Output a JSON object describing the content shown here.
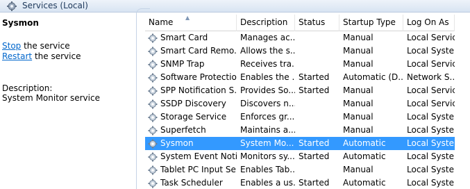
{
  "window": {
    "title": "Services (Local)",
    "icon": "gear-icon"
  },
  "details": {
    "service_name": "Sysmon",
    "stop_link": "Stop",
    "stop_suffix": " the service",
    "restart_link": "Restart",
    "restart_suffix": " the service",
    "description_label": "Description:",
    "description_text": "System Monitor service"
  },
  "list": {
    "columns": {
      "name": "Name",
      "description": "Description",
      "status": "Status",
      "startup_type": "Startup Type",
      "log_on_as": "Log On As"
    },
    "sort_column": "Name",
    "sort_direction": "ascending",
    "selection_color": "#3399ff",
    "rows": [
      {
        "name": "Smart Card",
        "description": "Manages ac...",
        "status": "",
        "startup": "Manual",
        "logon": "Local Service",
        "selected": false
      },
      {
        "name": "Smart Card Remo...",
        "description": "Allows the s...",
        "status": "",
        "startup": "Manual",
        "logon": "Local Syste...",
        "selected": false
      },
      {
        "name": "SNMP Trap",
        "description": "Receives tra...",
        "status": "",
        "startup": "Manual",
        "logon": "Local Service",
        "selected": false
      },
      {
        "name": "Software Protection",
        "description": "Enables the ...",
        "status": "Started",
        "startup": "Automatic (D...",
        "logon": "Network S...",
        "selected": false
      },
      {
        "name": "SPP Notification S...",
        "description": "Provides So...",
        "status": "Started",
        "startup": "Manual",
        "logon": "Local Service",
        "selected": false
      },
      {
        "name": "SSDP Discovery",
        "description": "Discovers n...",
        "status": "",
        "startup": "Manual",
        "logon": "Local Service",
        "selected": false
      },
      {
        "name": "Storage Service",
        "description": "Enforces gr...",
        "status": "",
        "startup": "Manual",
        "logon": "Local Syste...",
        "selected": false
      },
      {
        "name": "Superfetch",
        "description": "Maintains a...",
        "status": "",
        "startup": "Manual",
        "logon": "Local Syste...",
        "selected": false
      },
      {
        "name": "Sysmon",
        "description": "System Mo...",
        "status": "Started",
        "startup": "Automatic",
        "logon": "Local Syste...",
        "selected": true
      },
      {
        "name": "System Event Noti...",
        "description": "Monitors sy...",
        "status": "Started",
        "startup": "Automatic",
        "logon": "Local Syste...",
        "selected": false
      },
      {
        "name": "Tablet PC Input Se...",
        "description": "Enables Tab...",
        "status": "",
        "startup": "Manual",
        "logon": "Local Syste...",
        "selected": false
      },
      {
        "name": "Task Scheduler",
        "description": "Enables a us...",
        "status": "Started",
        "startup": "Automatic",
        "logon": "Local Syste...",
        "selected": false
      }
    ]
  }
}
